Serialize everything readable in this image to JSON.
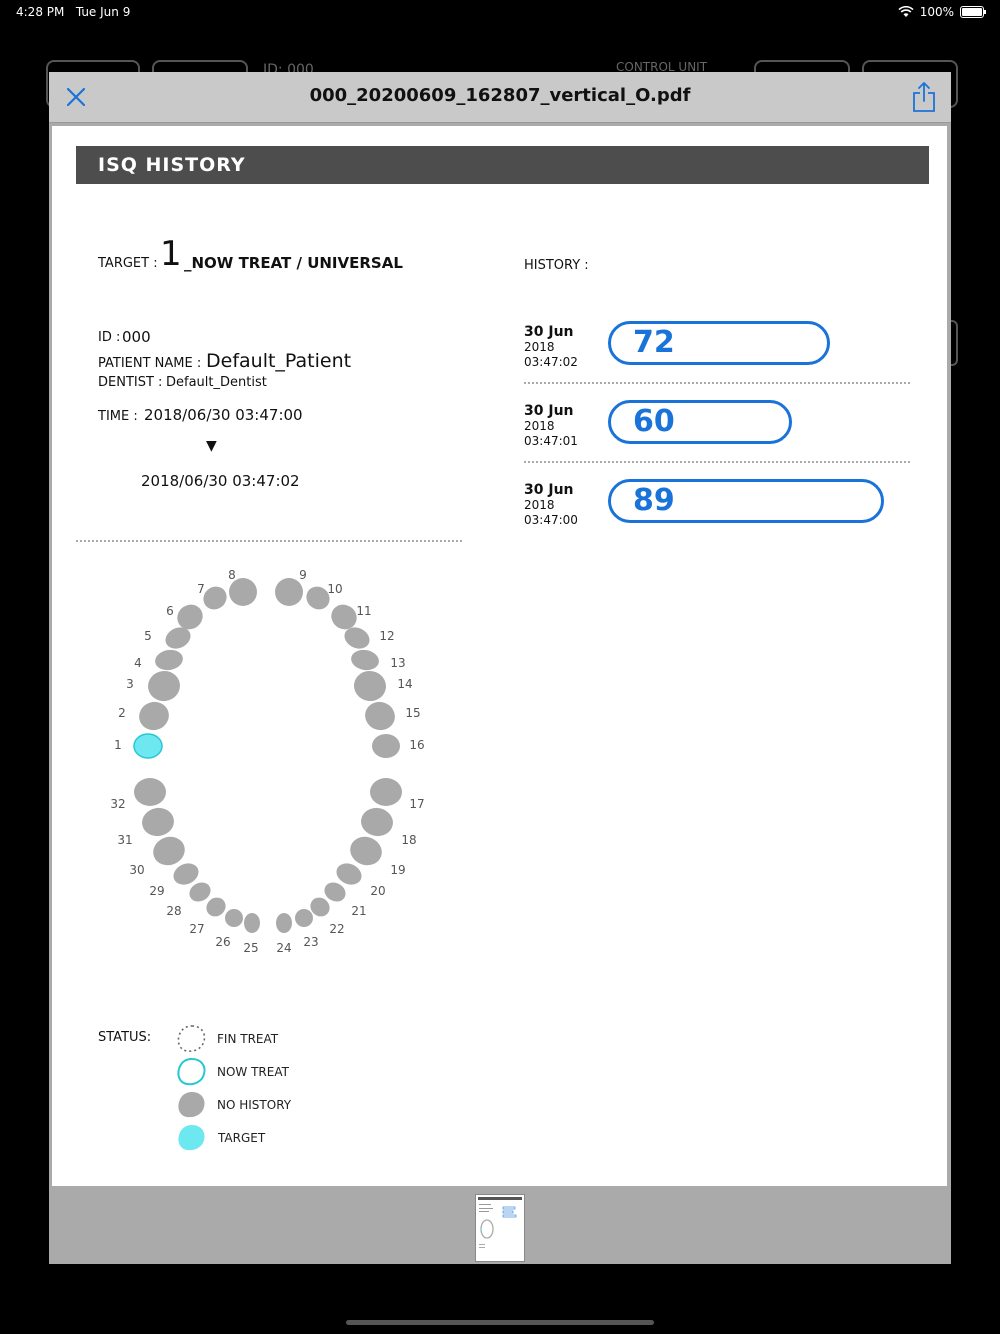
{
  "status_bar": {
    "time": "4:28 PM",
    "date": "Tue Jun 9",
    "battery": "100%"
  },
  "background": {
    "id_text": "ID: 000",
    "control_unit": "CONTROL UNIT"
  },
  "modal": {
    "title": "000_20200609_162807_vertical_O.pdf",
    "close_icon": "close-icon",
    "share_icon": "share-icon"
  },
  "report": {
    "heading": "ISQ HISTORY",
    "target_label": "TARGET :",
    "target_number": "1",
    "target_desc": "_NOW TREAT / UNIVERSAL",
    "id_label": "ID :",
    "id_value": "000",
    "patient_label": "PATIENT NAME :",
    "patient_value": "Default_Patient",
    "dentist_label": "DENTIST :",
    "dentist_value": "Default_Dentist",
    "time_label": "TIME :",
    "time_start": "2018/06/30 03:47:00",
    "time_arrow": "▼",
    "time_end": "2018/06/30 03:47:02",
    "history_label": "HISTORY :",
    "history": [
      {
        "date": "30 Jun",
        "year": "2018",
        "time": "03:47:02",
        "isq": 72
      },
      {
        "date": "30 Jun",
        "year": "2018",
        "time": "03:47:01",
        "isq": 60
      },
      {
        "date": "30 Jun",
        "year": "2018",
        "time": "03:47:00",
        "isq": 89
      }
    ],
    "status_label": "STATUS:",
    "legend": {
      "fin_treat": "FIN TREAT",
      "now_treat": "NOW TREAT",
      "no_history": "NO HISTORY",
      "target": "TARGET"
    },
    "colors": {
      "tooth_gray": "#a9a9a9",
      "target_cyan": "#6ee8f0",
      "isq_blue": "#1a73d9",
      "header_dark": "#4d4d4d"
    },
    "teeth": [
      "1",
      "2",
      "3",
      "4",
      "5",
      "6",
      "7",
      "8",
      "9",
      "10",
      "11",
      "12",
      "13",
      "14",
      "15",
      "16",
      "17",
      "18",
      "19",
      "20",
      "21",
      "22",
      "23",
      "24",
      "25",
      "26",
      "27",
      "28",
      "29",
      "30",
      "31",
      "32"
    ],
    "target_tooth": "1"
  }
}
